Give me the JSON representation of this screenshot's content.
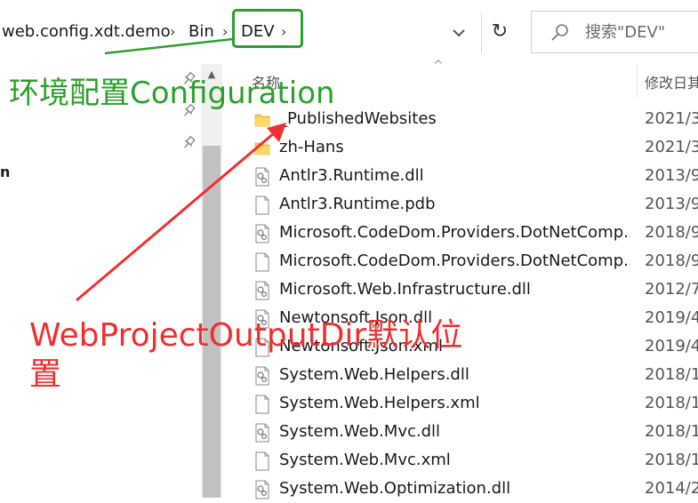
{
  "breadcrumb": {
    "items": [
      "web.config.xdt.demo",
      "Bin",
      "DEV"
    ],
    "separator": "›",
    "dropdown_icon": "chevron-down-icon"
  },
  "toolbar": {
    "refresh_icon": "refresh-icon",
    "refresh_glyph": "↻"
  },
  "search": {
    "placeholder": "搜索\"DEV\"",
    "icon": "search-icon"
  },
  "columns": {
    "name": "名称",
    "date": "修改日其",
    "sort_glyph": "^"
  },
  "files": [
    {
      "name": "_PublishedWebsites",
      "date": "2021/3",
      "icon": "folder-icon"
    },
    {
      "name": "zh-Hans",
      "date": "2021/3",
      "icon": "folder-icon"
    },
    {
      "name": "Antlr3.Runtime.dll",
      "date": "2013/9",
      "icon": "dll-file-icon"
    },
    {
      "name": "Antlr3.Runtime.pdb",
      "date": "2013/9",
      "icon": "file-icon"
    },
    {
      "name": "Microsoft.CodeDom.Providers.DotNetComp...",
      "date": "2018/9",
      "icon": "dll-file-icon"
    },
    {
      "name": "Microsoft.CodeDom.Providers.DotNetComp...",
      "date": "2018/9",
      "icon": "file-icon"
    },
    {
      "name": "Microsoft.Web.Infrastructure.dll",
      "date": "2012/7",
      "icon": "dll-file-icon"
    },
    {
      "name": "Newtonsoft.Json.dll",
      "date": "2019/4",
      "icon": "dll-file-icon"
    },
    {
      "name": "Newtonsoft.Json.xml",
      "date": "2019/4",
      "icon": "file-icon"
    },
    {
      "name": "System.Web.Helpers.dll",
      "date": "2018/1",
      "icon": "dll-file-icon"
    },
    {
      "name": "System.Web.Helpers.xml",
      "date": "2018/1",
      "icon": "file-icon"
    },
    {
      "name": "System.Web.Mvc.dll",
      "date": "2018/1",
      "icon": "dll-file-icon"
    },
    {
      "name": "System.Web.Mvc.xml",
      "date": "2018/1",
      "icon": "file-icon"
    },
    {
      "name": "System.Web.Optimization.dll",
      "date": "2014/2",
      "icon": "dll-file-icon"
    }
  ],
  "left_pane": {
    "pins": [
      "pin-icon",
      "pin-icon",
      "pin-icon"
    ],
    "fragment": "n"
  },
  "annotations": {
    "green_text": "环境配置Configuration",
    "red_text_line1": "WebProjectOutputDir默认位",
    "red_text_line2": "置",
    "green_color": "#2ca02c",
    "red_color": "#f03030"
  }
}
